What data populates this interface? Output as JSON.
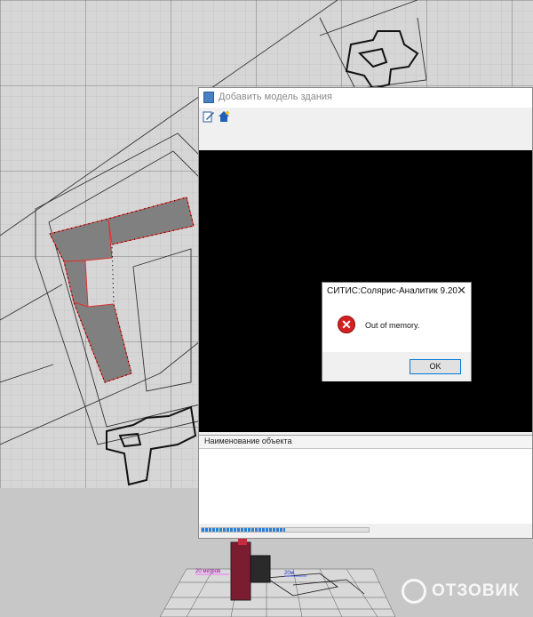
{
  "window": {
    "title": "Добавить модель здания",
    "object_header": "Наименование объекта",
    "progress": 0.5
  },
  "toolbar": {
    "icons": [
      "edit-icon",
      "home-icon"
    ]
  },
  "dialog": {
    "title": "СИТИС:Солярис-Аналитик 9.20",
    "close": "✕",
    "icon": "error-icon",
    "message": "Out of memory.",
    "ok_label": "OK"
  },
  "scene3d": {
    "label_left": "20 метров",
    "label_right": "20м"
  },
  "watermark": {
    "text": "ОТЗОВИК"
  },
  "colors": {
    "accent": "#0078d7",
    "error": "#d32020",
    "building_outline": "#e03030",
    "building_fill": "#808080"
  }
}
